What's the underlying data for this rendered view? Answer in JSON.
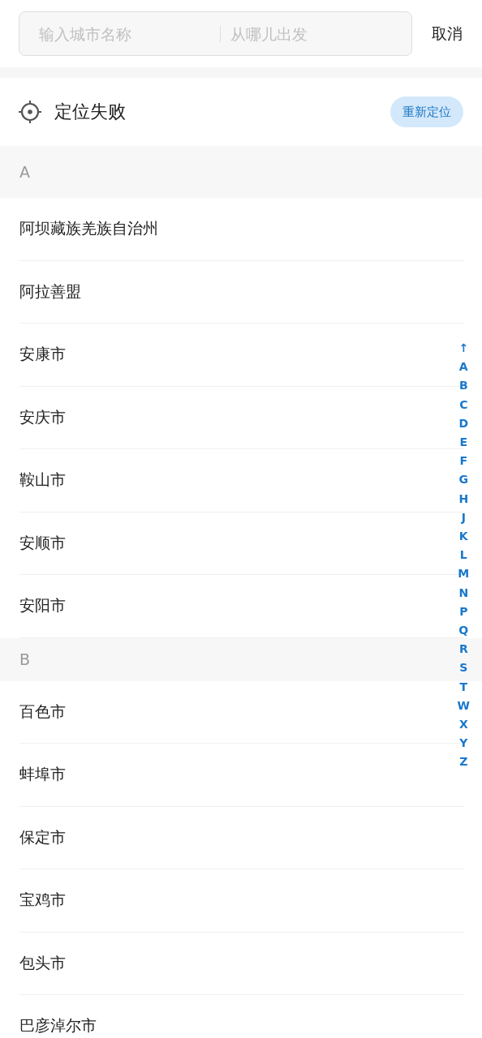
{
  "search": {
    "city_placeholder": "输入城市名称",
    "origin_placeholder": "从哪儿出发",
    "cancel": "取消"
  },
  "location": {
    "status": "定位失败",
    "retry": "重新定位"
  },
  "sections": [
    {
      "letter": "A",
      "cities": [
        "阿坝藏族羌族自治州",
        "阿拉善盟",
        "安康市",
        "安庆市",
        "鞍山市",
        "安顺市",
        "安阳市"
      ]
    },
    {
      "letter": "B",
      "cities": [
        "百色市",
        "蚌埠市",
        "保定市",
        "宝鸡市",
        "包头市",
        "巴彦淖尔市"
      ]
    }
  ],
  "index": [
    "↑",
    "A",
    "B",
    "C",
    "D",
    "E",
    "F",
    "G",
    "H",
    "J",
    "K",
    "L",
    "M",
    "N",
    "P",
    "Q",
    "R",
    "S",
    "T",
    "W",
    "X",
    "Y",
    "Z"
  ]
}
